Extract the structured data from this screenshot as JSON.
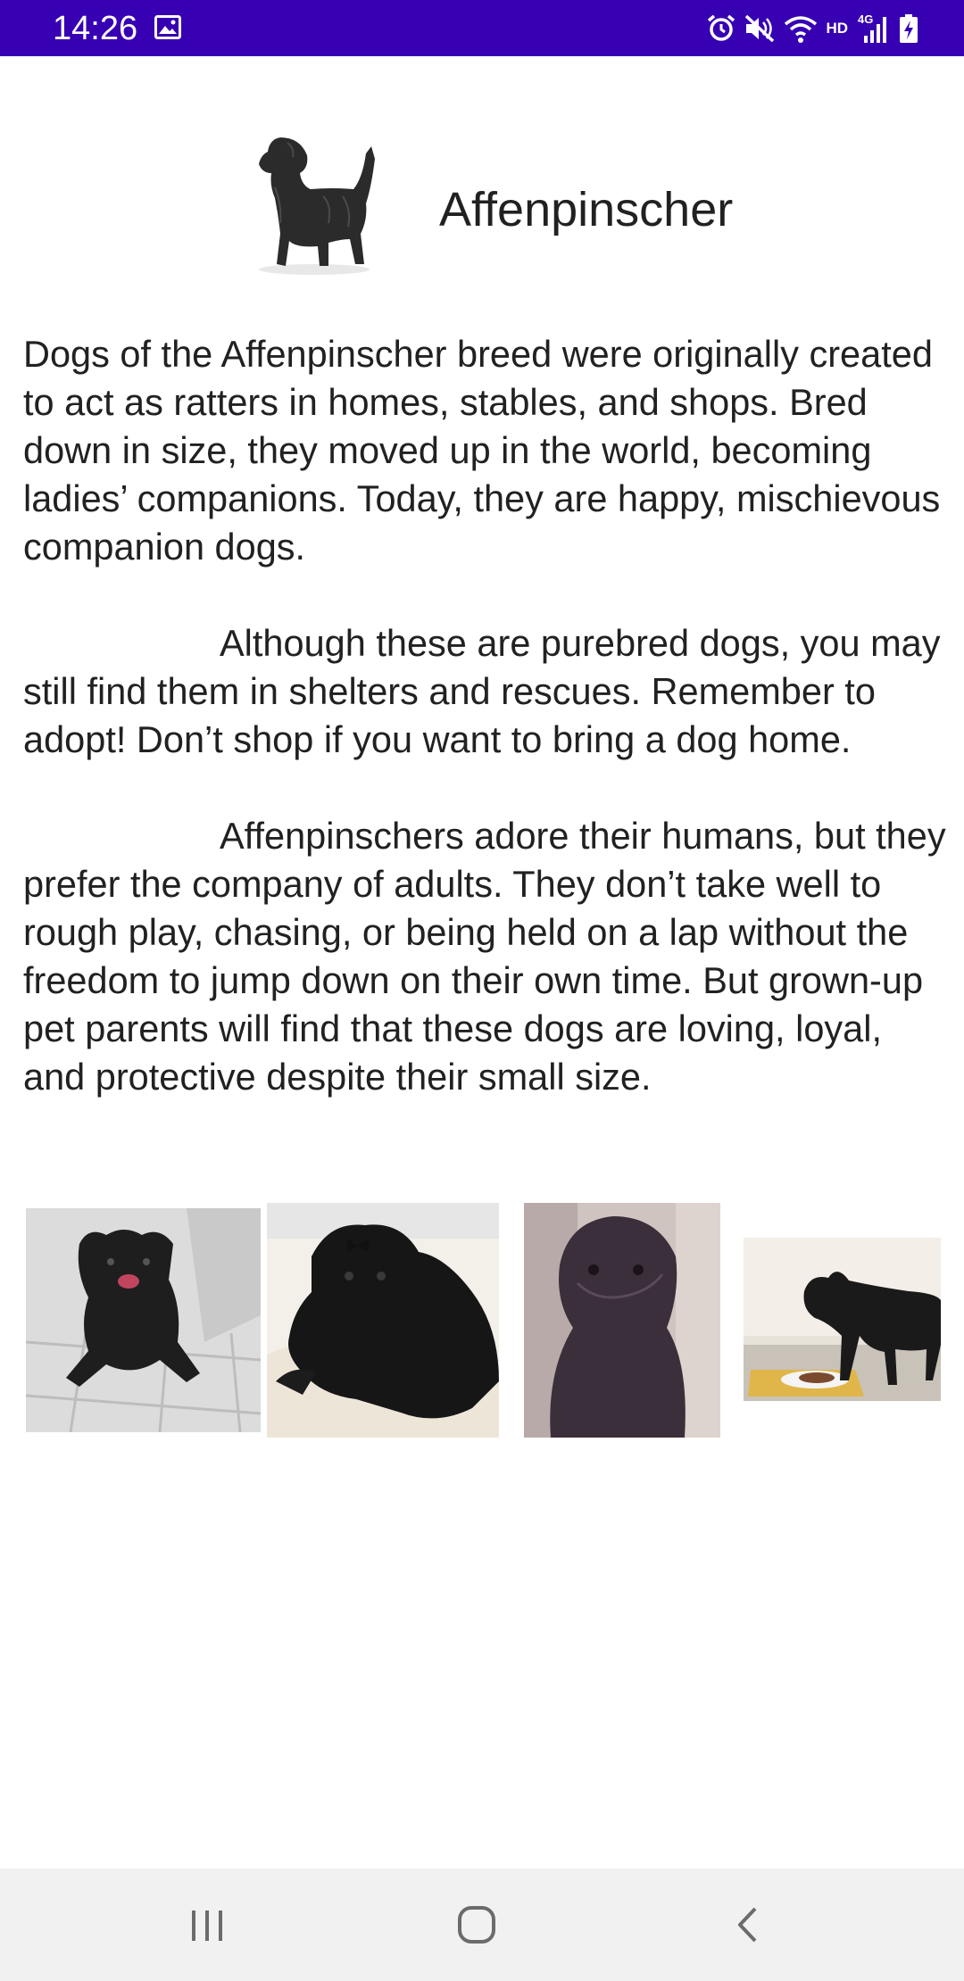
{
  "status_bar": {
    "time": "14:26",
    "network_label": "HD",
    "network_type": "4G",
    "icons": [
      "gallery-icon",
      "alarm-icon",
      "mute-icon",
      "wifi-icon",
      "signal-icon",
      "battery-icon"
    ]
  },
  "header": {
    "title": "Affenpinscher",
    "image_icon": "dog-silhouette-image"
  },
  "description": {
    "paragraph_1": "Dogs of the Affenpinscher breed were originally created to act as ratters in homes, stables, and shops. Bred down in size, they moved up in the world, becoming ladies’ companions. Today, they are happy, mischievous companion dogs.",
    "paragraph_2": "Although these are purebred dogs, you may still find them in shelters and rescues. Remember to adopt! Don’t shop if you want to bring a dog home.",
    "paragraph_3": "Affenpinschers adore their humans, but they prefer the company of adults. They don’t take well to rough play, chasing, or being held on a lap without the freedom to jump down on their own time. But grown-up pet parents will find that these dogs are loving, loyal, and protective despite their small size."
  },
  "gallery": {
    "photos": [
      "dog-on-tiles-photo",
      "dog-with-bow-photo",
      "dog-sitting-photo",
      "dog-with-food-photo"
    ]
  },
  "nav_bar": {
    "buttons": [
      "recents-icon",
      "home-icon",
      "back-icon"
    ]
  },
  "colors": {
    "status_bar": "#3700b3",
    "text": "#212121",
    "background": "#ffffff",
    "nav_bar": "#f1f1f1",
    "nav_icon": "#6b6b6b"
  }
}
